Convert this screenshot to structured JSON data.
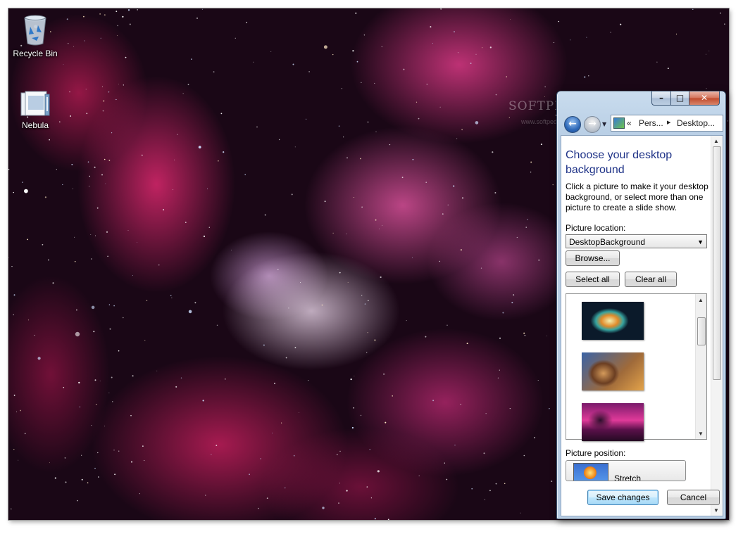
{
  "desktop": {
    "icons": [
      {
        "label": "Recycle Bin",
        "icon": "recycle-bin-icon"
      },
      {
        "label": "Nebula",
        "icon": "theme-file-icon"
      }
    ],
    "wallpaper": "nebula",
    "watermark": {
      "brand": "SOFTPEDIA",
      "url": "www.softpedia.com"
    }
  },
  "window": {
    "caption_buttons": {
      "minimize": "–",
      "maximize": "□",
      "close": "✕"
    },
    "nav": {
      "back_glyph": "←",
      "forward_glyph": "→",
      "recent_glyph": "▼"
    },
    "address": {
      "prefix": "«",
      "crumbs": [
        "Pers...",
        "Desktop..."
      ],
      "separator": "▶"
    },
    "heading": "Choose your desktop background",
    "description": "Click a picture to make it your desktop background, or select more than one picture to create a slide show.",
    "picture_location": {
      "label": "Picture location:",
      "value": "DesktopBackground",
      "arrow": "▼"
    },
    "buttons": {
      "browse": "Browse...",
      "select_all": "Select all",
      "clear_all": "Clear all",
      "save": "Save changes",
      "cancel": "Cancel"
    },
    "thumbnails": [
      {
        "name": "crab-nebula"
      },
      {
        "name": "pillars-nebula"
      },
      {
        "name": "horsehead-nebula"
      }
    ],
    "picture_position": {
      "label": "Picture position:",
      "value": "Stretch"
    },
    "scroll_glyphs": {
      "up": "▲",
      "down": "▼",
      "grip": "≡"
    }
  },
  "colors": {
    "heading": "#1e3287",
    "accent": "#3c7fb1"
  }
}
